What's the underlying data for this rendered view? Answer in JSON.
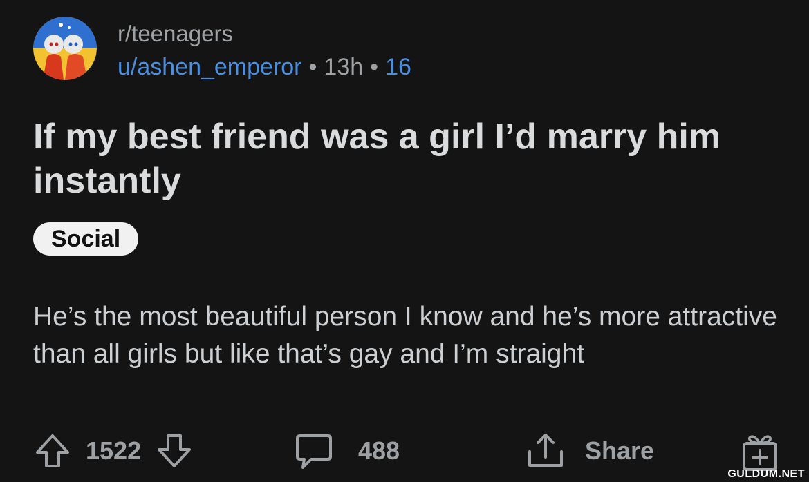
{
  "post": {
    "subreddit": "r/teenagers",
    "username": "u/ashen_emperor",
    "time": "13h",
    "awards_count": "16",
    "separator": "•",
    "title": "If my best friend was a girl I’d marry him instantly",
    "flair": "Social",
    "body": "He’s the most beautiful person I know and he’s more attractive than all girls but like that’s gay and I’m straight"
  },
  "actions": {
    "upvotes": "1522",
    "comments": "488",
    "share_label": "Share"
  },
  "watermark": "GULDUM.NET",
  "icons": {
    "upvote": "arrow-up-icon",
    "downvote": "arrow-down-icon",
    "comment": "speech-bubble-icon",
    "share": "share-icon",
    "award": "gift-plus-icon"
  },
  "colors": {
    "background": "#141414",
    "link": "#4a8fe0",
    "flair_bg": "#f1f1f1"
  }
}
